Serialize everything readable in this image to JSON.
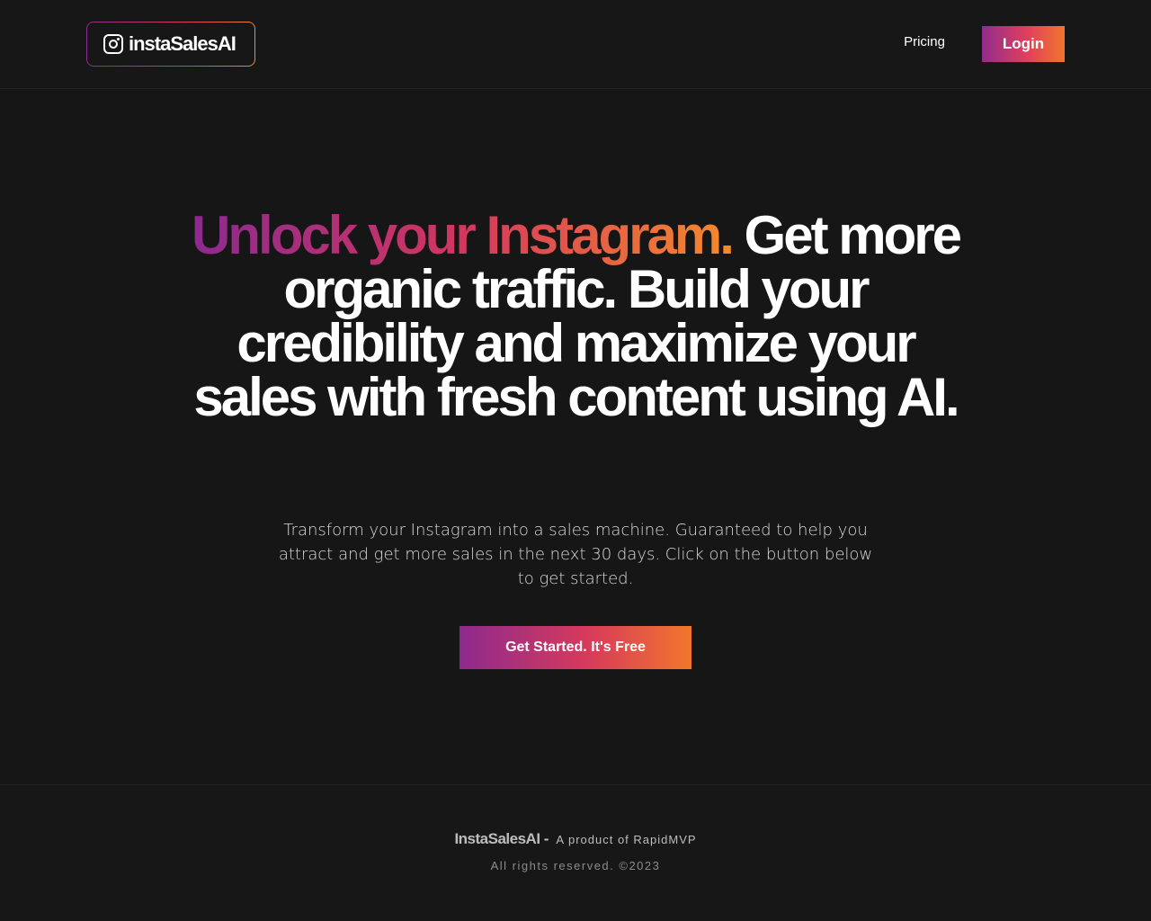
{
  "header": {
    "logo_text": "instaSalesAI",
    "logo_icon": "instagram-icon",
    "nav": {
      "pricing_label": "Pricing",
      "login_label": "Login"
    }
  },
  "hero": {
    "title_accent": "Unlock your Instagram.",
    "title_rest": " Get more organic traffic. Build your credibility and maximize your sales with fresh content using AI.",
    "subtitle": "Transform your Instagram into a sales machine. Guaranteed to help you attract and get more sales in the next 30 days. Click on the button below to get started.",
    "cta_label": "Get Started. It's Free"
  },
  "footer": {
    "brand": "InstaSalesAI -",
    "product_text": "A product of RapidMVP",
    "rights": "All rights reserved. ©2023"
  },
  "colors": {
    "background": "#161616",
    "gradient_start": "#8e2a8e",
    "gradient_mid": "#d63a5b",
    "gradient_end": "#f2762c",
    "text": "#ffffff"
  }
}
